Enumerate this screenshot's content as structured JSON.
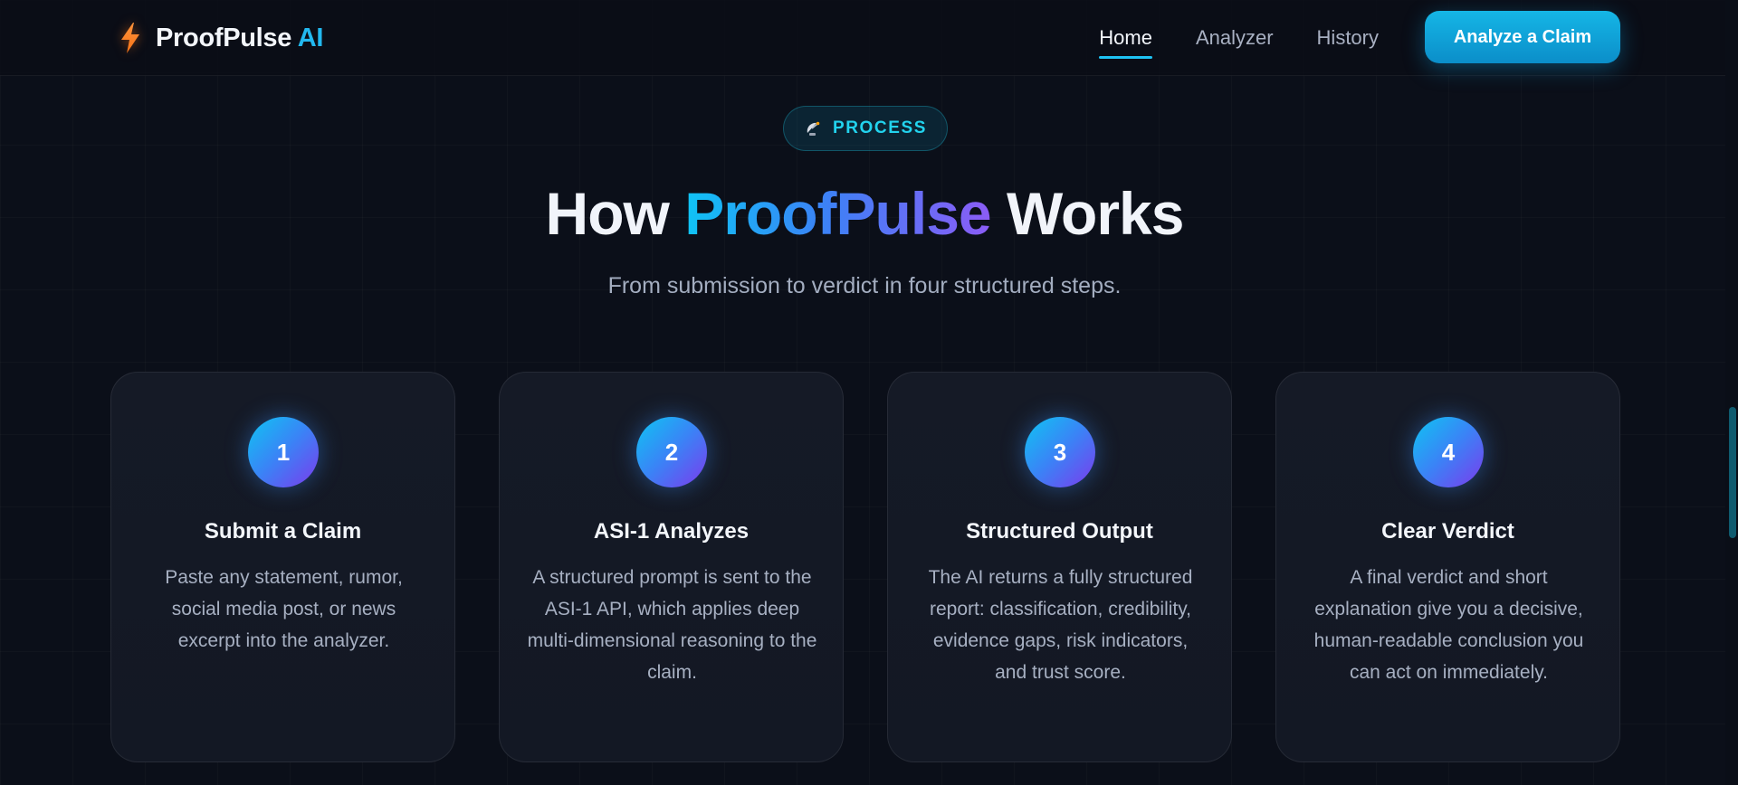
{
  "nav": {
    "brand_name": "ProofPulse",
    "brand_suffix": "AI",
    "links": [
      {
        "label": "Home",
        "active": true
      },
      {
        "label": "Analyzer",
        "active": false
      },
      {
        "label": "History",
        "active": false
      }
    ],
    "cta_label": "Analyze a Claim"
  },
  "hero": {
    "badge_icon": "satellite-dish-icon",
    "badge_label": "PROCESS",
    "headline_pre": "How",
    "headline_brand": "ProofPulse",
    "headline_post": "Works",
    "subheadline": "From submission to verdict in four structured steps."
  },
  "steps": [
    {
      "number": "1",
      "title": "Submit a Claim",
      "description": "Paste any statement, rumor, social media post, or news excerpt into the analyzer."
    },
    {
      "number": "2",
      "title": "ASI-1 Analyzes",
      "description": "A structured prompt is sent to the ASI-1 API, which applies deep multi-dimensional reasoning to the claim."
    },
    {
      "number": "3",
      "title": "Structured Output",
      "description": "The AI returns a fully structured report: classification, credibility, evidence gaps, risk indicators, and trust score."
    },
    {
      "number": "4",
      "title": "Clear Verdict",
      "description": "A final verdict and short explanation give you a decisive, human-readable conclusion you can act on immediately."
    }
  ],
  "colors": {
    "background": "#0b0f19",
    "accent": "#22b8ef",
    "cta": "#0ea5e9",
    "badge_text": "#22d3ee",
    "gradient_start": "#0fc4f5",
    "gradient_end": "#8b5cf6",
    "bolt": "#f97316"
  }
}
